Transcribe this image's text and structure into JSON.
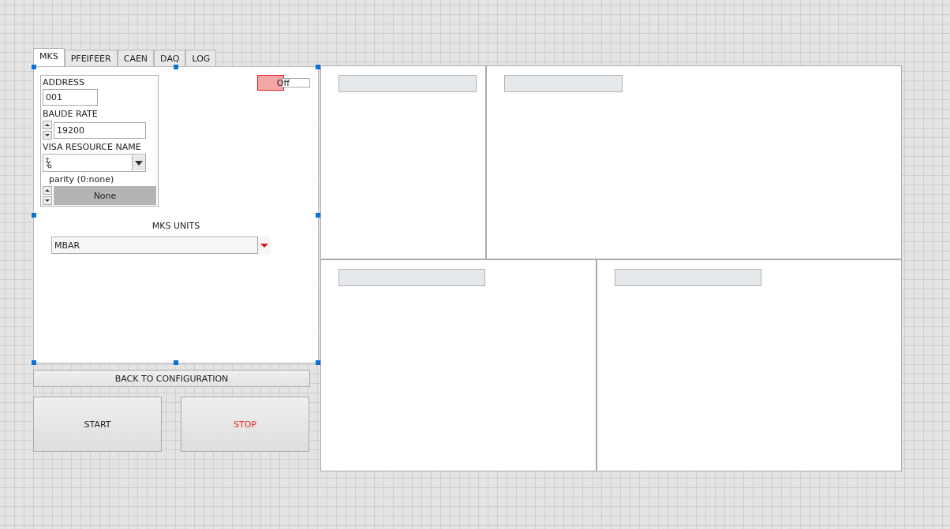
{
  "tabs": [
    {
      "label": "MKS",
      "selected": true
    },
    {
      "label": "PFEIFEER",
      "selected": false
    },
    {
      "label": "CAEN",
      "selected": false
    },
    {
      "label": "DAQ",
      "selected": false
    },
    {
      "label": "LOG",
      "selected": false
    }
  ],
  "serial_settings": {
    "address": {
      "label": "ADDRESS",
      "value": "001"
    },
    "baud_rate": {
      "label": "BAUDE RATE",
      "value": "19200"
    },
    "visa_resource_name": {
      "label": "VISA RESOURCE NAME"
    },
    "parity": {
      "label": "parity (0:none)",
      "value": "None"
    }
  },
  "power_switch": {
    "label": "Off",
    "on": false
  },
  "units": {
    "label": "MKS UNITS",
    "value": "MBAR"
  },
  "buttons": {
    "back": "BACK TO CONFIGURATION",
    "start": "START",
    "stop": "STOP"
  },
  "display_panels": [
    {
      "kind": "panel"
    },
    {
      "kind": "panel"
    },
    {
      "kind": "panel"
    },
    {
      "kind": "panel"
    }
  ]
}
